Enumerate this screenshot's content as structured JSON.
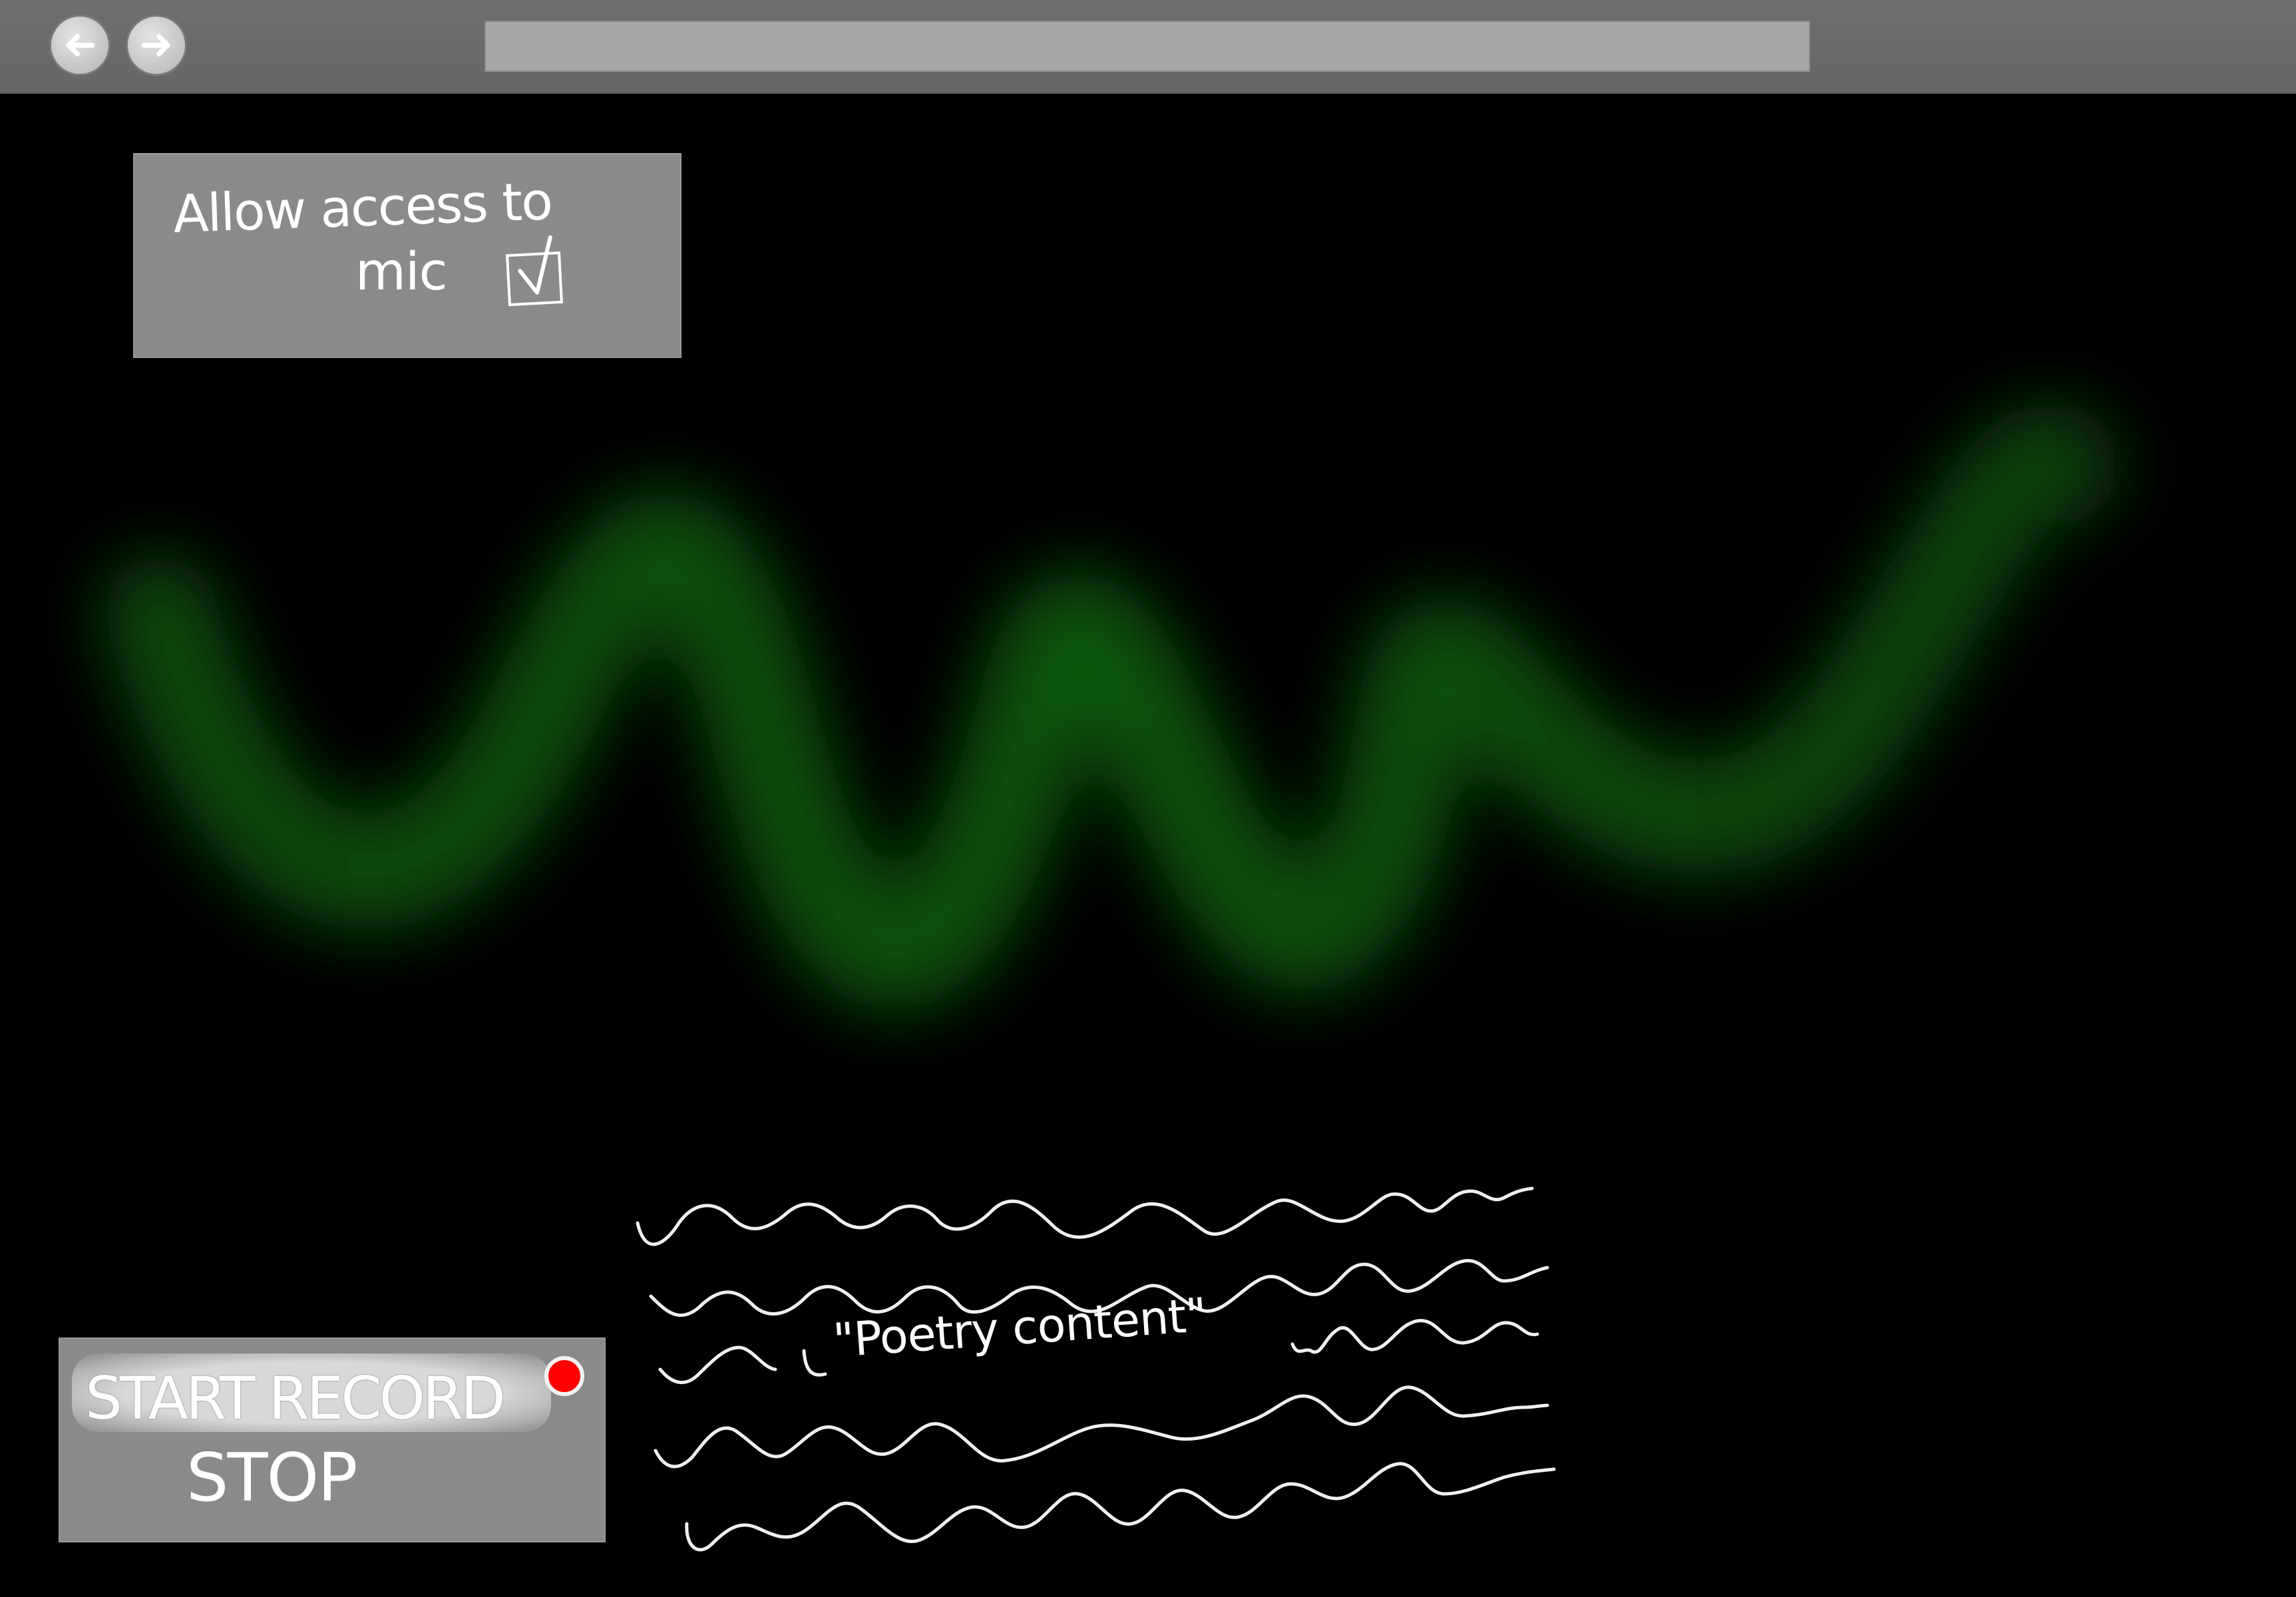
{
  "browser": {
    "back_icon": "arrow-left-icon",
    "forward_icon": "arrow-right-icon",
    "address": ""
  },
  "mic_panel": {
    "line1": "Allow access to",
    "line2": "mic",
    "checked": true,
    "checkbox_icon": "checkmark-icon"
  },
  "record_panel": {
    "start_label": "START RECORD",
    "record_indicator_color": "#ff0000",
    "stop_label": "STOP"
  },
  "poetry": {
    "label": "\"Poetry content\"",
    "placeholder_lines": 5
  },
  "colors": {
    "background": "#000000",
    "panel": "#8a8a8a",
    "wave_glow": "#0a5a0a",
    "toolbar": "#6b6b6b"
  }
}
